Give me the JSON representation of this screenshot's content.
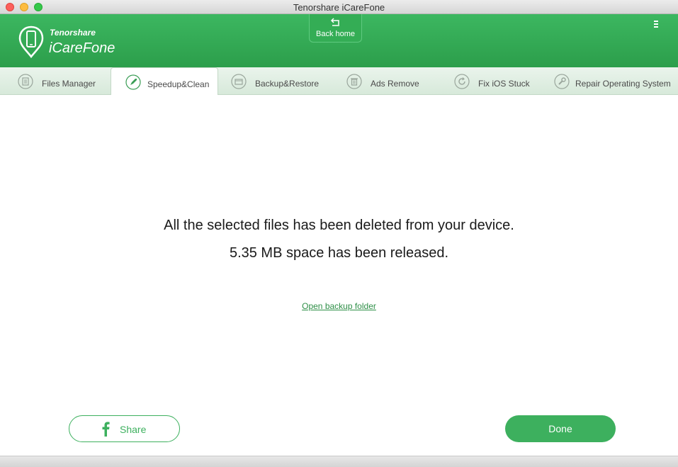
{
  "window": {
    "title": "Tenorshare iCareFone"
  },
  "header": {
    "brand_small": "Tenorshare",
    "brand_big": "iCareFone",
    "back_home_label": "Back home",
    "accent_color": "#34a853"
  },
  "tabs": [
    {
      "label": "Files Manager",
      "icon": "files-icon",
      "active": false
    },
    {
      "label": "Speedup&Clean",
      "icon": "rocket-icon",
      "active": true
    },
    {
      "label": "Backup&Restore",
      "icon": "backup-icon",
      "active": false
    },
    {
      "label": "Ads Remove",
      "icon": "trash-icon",
      "active": false
    },
    {
      "label": "Fix iOS Stuck",
      "icon": "refresh-icon",
      "active": false
    },
    {
      "label": "Repair Operating System",
      "icon": "wrench-icon",
      "active": false
    }
  ],
  "main": {
    "message_line1": "All the selected files has been deleted from your device.",
    "message_line2": "5.35 MB  space has been released.",
    "open_backup_link": "Open backup folder"
  },
  "footer": {
    "share_label": "Share",
    "done_label": "Done"
  }
}
